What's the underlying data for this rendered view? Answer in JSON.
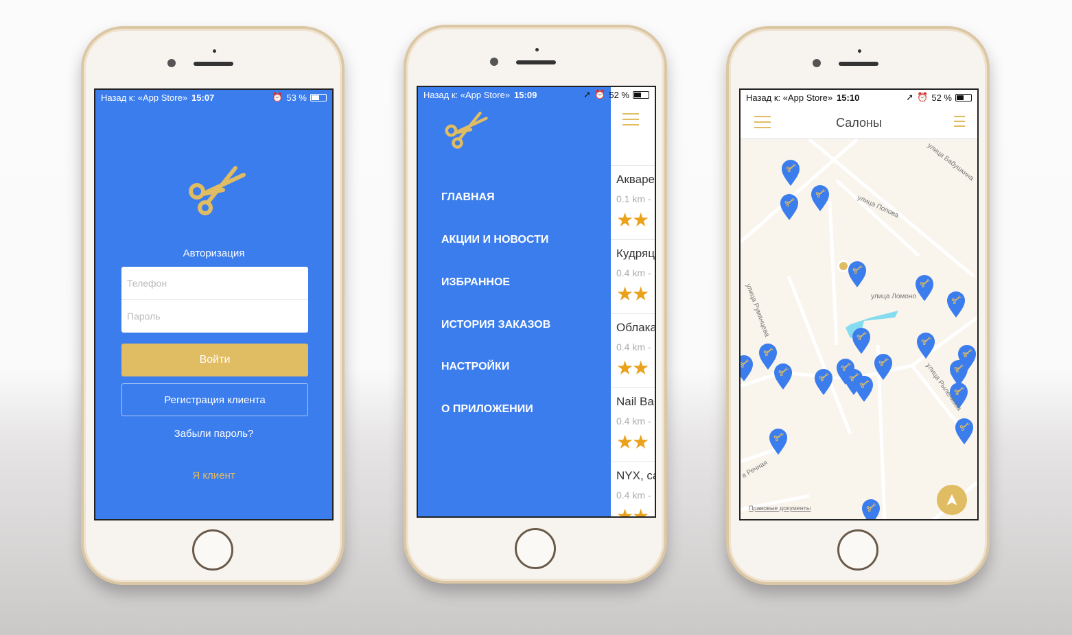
{
  "colors": {
    "brand_blue": "#3b7ded",
    "gold": "#e0bc62",
    "star": "#eaa21a",
    "map_bg": "#f9f4ec"
  },
  "phone1": {
    "status": {
      "back": "Назад к: «App Store»",
      "time": "15:07",
      "battery": "53 %",
      "battery_level": 0.53
    },
    "title": "Авторизация",
    "phone_placeholder": "Телефон",
    "password_placeholder": "Пароль",
    "login": "Войти",
    "register": "Регистрация клиента",
    "forgot": "Забыли пароль?",
    "client": "Я клиент"
  },
  "phone2": {
    "status": {
      "back": "Назад к: «App Store»",
      "time": "15:09",
      "battery": "52 %",
      "battery_level": 0.52
    },
    "menu": [
      "ГЛАВНАЯ",
      "АКЦИИ И НОВОСТИ",
      "ИЗБРАННОЕ",
      "ИСТОРИЯ ЗАКАЗОВ",
      "НАСТРОЙКИ",
      "О ПРИЛОЖЕНИИ"
    ],
    "list": [
      {
        "name": "Акваре",
        "dist": "0.1 km -",
        "stars": "★★"
      },
      {
        "name": "Кудряц",
        "dist": "0.4 km -",
        "stars": "★★"
      },
      {
        "name": "Облака",
        "dist": "0.4 km -",
        "stars": "★★"
      },
      {
        "name": "Nail Ba",
        "dist": "0.4 km -",
        "stars": "★★"
      },
      {
        "name": "NYX, ca",
        "dist": "0.4 km -",
        "stars": "★★"
      }
    ]
  },
  "phone3": {
    "status": {
      "back": "Назад к: «App Store»",
      "time": "15:10",
      "battery": "52 %",
      "battery_level": 0.52
    },
    "title": "Салоны",
    "streets": [
      "улица Бабушкина",
      "улица Попова",
      "улица Ломоно",
      "улица Румянцева",
      "улица Рыленкова",
      "а Речная"
    ],
    "legal": "Правовые документы"
  }
}
